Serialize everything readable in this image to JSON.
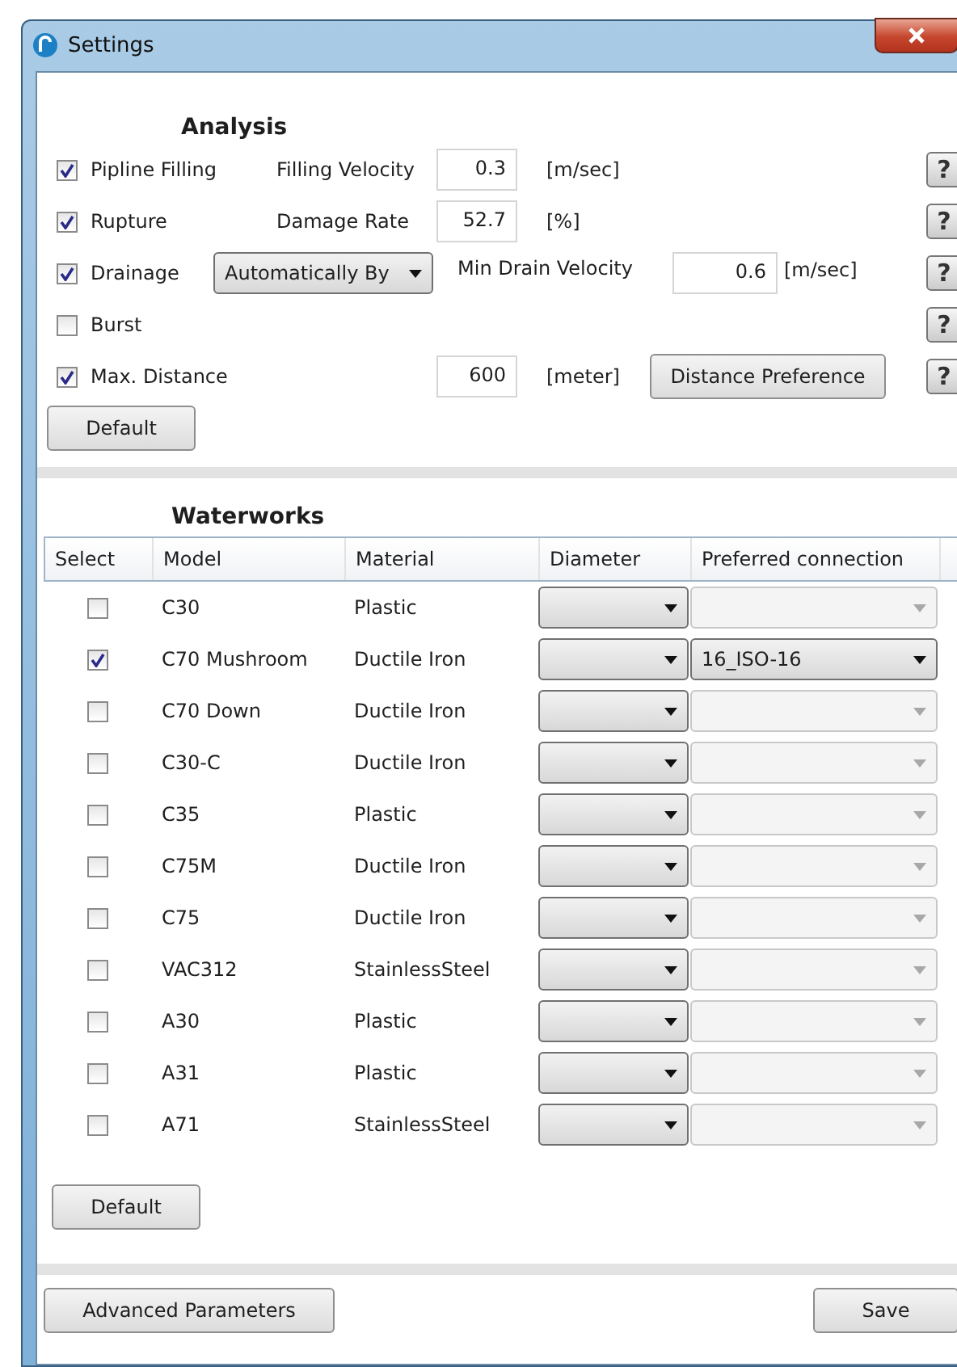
{
  "window": {
    "title": "Settings"
  },
  "analysis": {
    "title": "Analysis",
    "rows": [
      {
        "kind": "value",
        "label": "Pipline Filling",
        "checked": true,
        "param_label": "Filling Velocity",
        "value": "0.3",
        "unit": "[m/sec]",
        "help": "?"
      },
      {
        "kind": "value",
        "label": "Rupture",
        "checked": true,
        "param_label": "Damage Rate",
        "value": "52.7",
        "unit": "[%]",
        "help": "?"
      },
      {
        "kind": "dropdown",
        "label": "Drainage",
        "checked": true,
        "option": "Automatically By",
        "param_label": "Min Drain Velocity",
        "value": "0.6",
        "unit": "[m/sec]",
        "help": "?"
      },
      {
        "kind": "plain",
        "label": "Burst",
        "checked": false,
        "help": "?"
      },
      {
        "kind": "button",
        "label": "Max. Distance",
        "checked": true,
        "value": "600",
        "unit": "[meter]",
        "button_label": "Distance Preference",
        "help": "?"
      }
    ],
    "default_button": "Default"
  },
  "waterworks": {
    "title": "Waterworks",
    "columns": [
      "Select",
      "Model",
      "Material",
      "Diameter",
      "Preferred connection"
    ],
    "rows": [
      {
        "selected": false,
        "model": "C30",
        "material": "Plastic"
      },
      {
        "selected": true,
        "model": "C70 Mushroom",
        "material": "Ductile Iron",
        "connection": "16_ISO-16"
      },
      {
        "selected": false,
        "model": "C70 Down",
        "material": "Ductile Iron"
      },
      {
        "selected": false,
        "model": "C30-C",
        "material": "Ductile Iron"
      },
      {
        "selected": false,
        "model": "C35",
        "material": "Plastic"
      },
      {
        "selected": false,
        "model": "C75M",
        "material": "Ductile Iron"
      },
      {
        "selected": false,
        "model": "C75",
        "material": "Ductile Iron"
      },
      {
        "selected": false,
        "model": "VAC312",
        "material": "StainlessSteel"
      },
      {
        "selected": false,
        "model": "A30",
        "material": "Plastic"
      },
      {
        "selected": false,
        "model": "A31",
        "material": "Plastic"
      },
      {
        "selected": false,
        "model": "A71",
        "material": "StainlessSteel"
      }
    ],
    "default_button": "Default"
  },
  "footer": {
    "left_button": "Advanced Parameters",
    "right_button": "Save"
  }
}
